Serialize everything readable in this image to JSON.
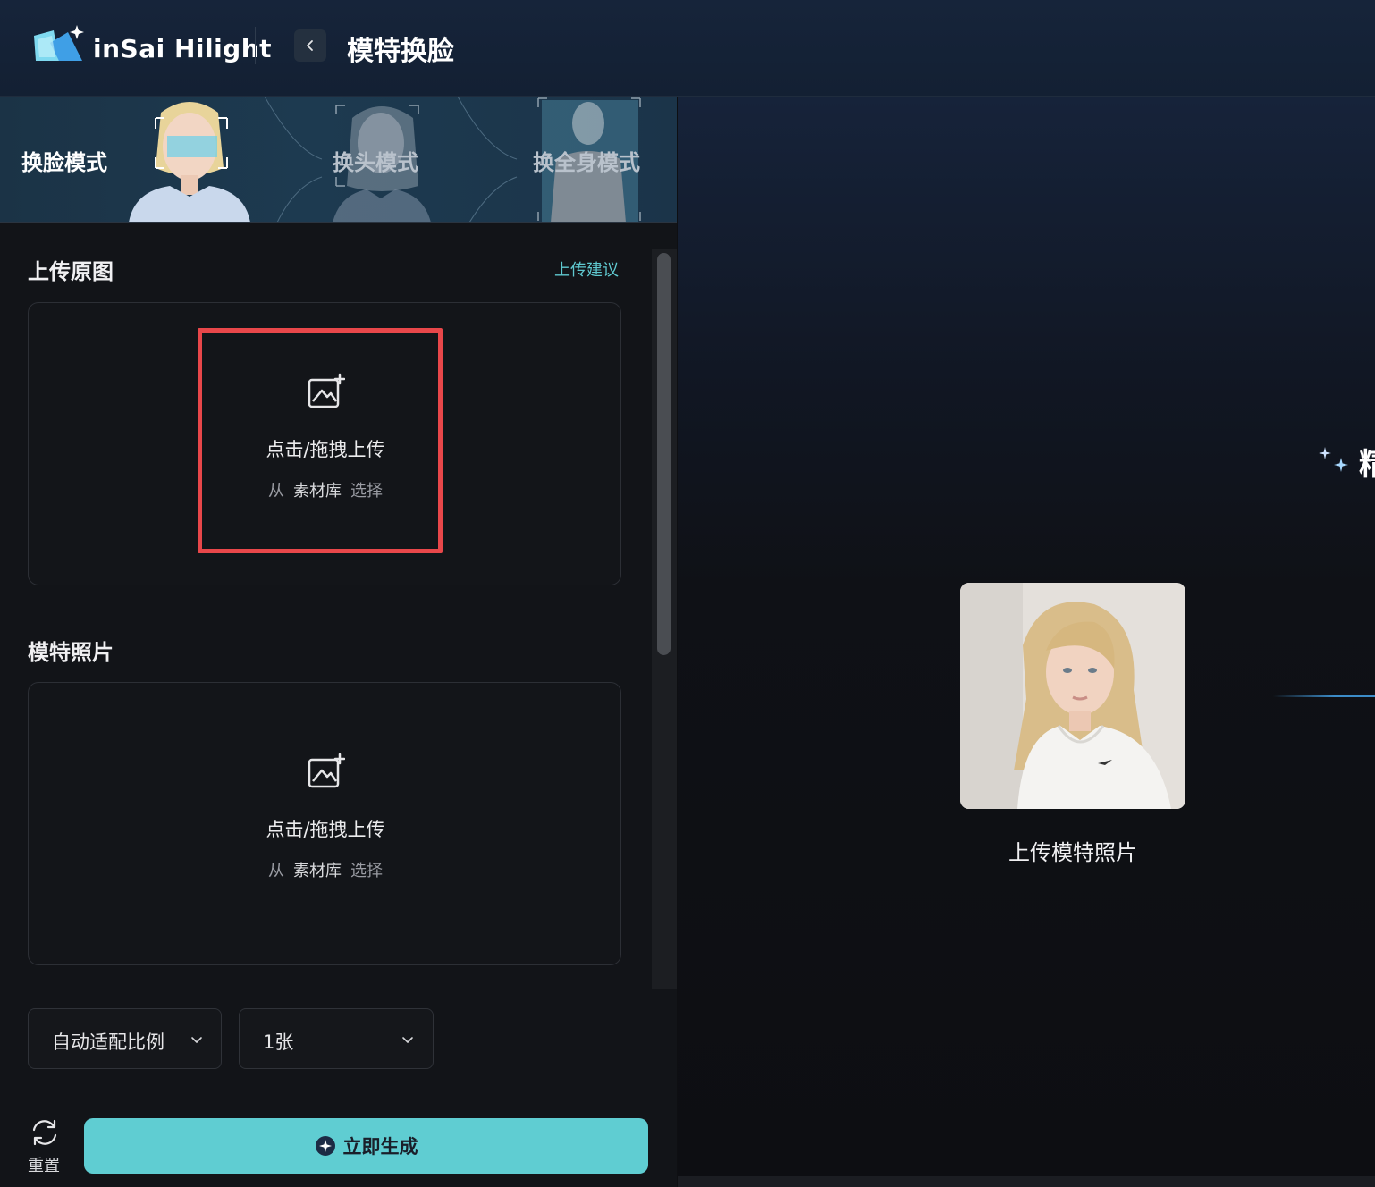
{
  "header": {
    "logo_text": "inSai Hilight",
    "title": "模特换脸"
  },
  "modes": [
    {
      "label": "换脸模式",
      "active": true
    },
    {
      "label": "换头模式",
      "active": false
    },
    {
      "label": "换全身模式",
      "active": false
    }
  ],
  "source": {
    "title": "上传原图",
    "tip": "上传建议",
    "upload_text": "点击/拖拽上传",
    "from": "从",
    "library": "素材库",
    "select": "选择"
  },
  "model": {
    "title": "模特照片",
    "upload_text": "点击/拖拽上传",
    "from": "从",
    "library": "素材库",
    "select": "选择"
  },
  "options": {
    "ratio": "自动适配比例",
    "count": "1张"
  },
  "footer": {
    "reset": "重置",
    "generate": "立即生成"
  },
  "preview": {
    "caption": "上传模特照片",
    "cut_text": "精"
  },
  "colors": {
    "accent": "#5fcdd2",
    "highlight": "#e8474a",
    "tip": "#5fc8cf"
  }
}
